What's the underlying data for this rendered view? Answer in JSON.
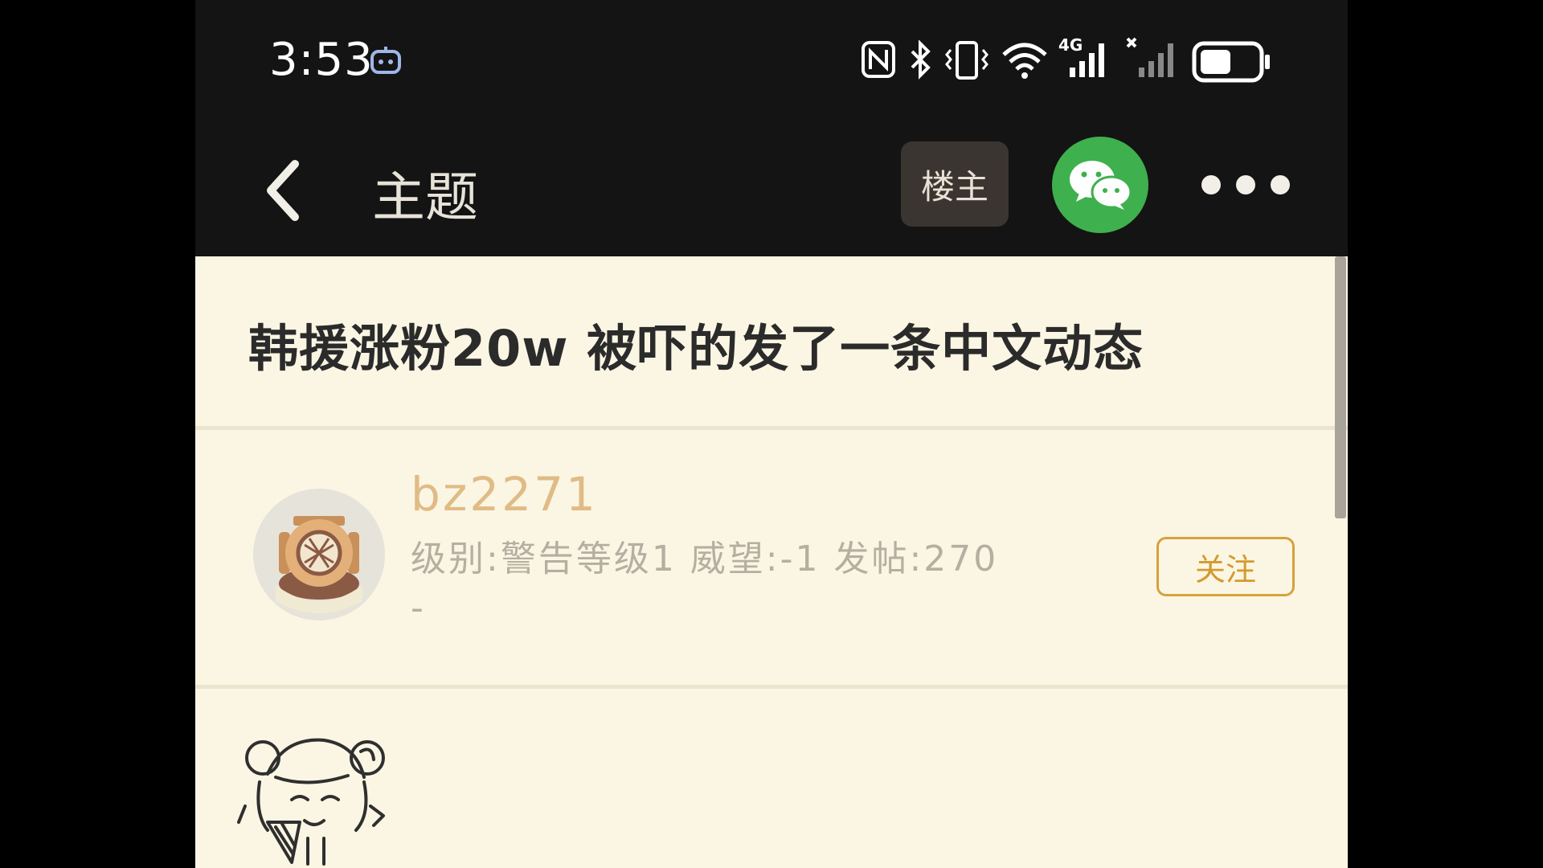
{
  "status_bar": {
    "time": "3:53",
    "network_label": "4G",
    "battery_level": 0.55,
    "icons": [
      "assistant-icon",
      "nfc-icon",
      "bluetooth-icon",
      "vibrate-icon",
      "wifi-icon",
      "signal-4g-icon",
      "signal-no-service-icon",
      "battery-icon"
    ]
  },
  "nav": {
    "title": "主题",
    "op_label": "楼主",
    "icons": [
      "back-arrow-icon",
      "wechat-icon",
      "more-dots-icon"
    ]
  },
  "topic": {
    "title": "韩援涨粉20w 被吓的发了一条中文动态"
  },
  "author": {
    "username": "bz2271",
    "stats": "级别:警告等级1 威望:-1 发帖:270",
    "signature": "-",
    "follow_label": "关注",
    "avatar_icon": "diver-helmet-avatar"
  },
  "post": {
    "sticker_icon": "anime-girl-sticker"
  },
  "colors": {
    "header_bg": "#141414",
    "content_bg": "#fbf6e3",
    "username": "#e0bb85",
    "follow_accent": "#d6a23c",
    "wechat_green": "#3fb04e"
  }
}
